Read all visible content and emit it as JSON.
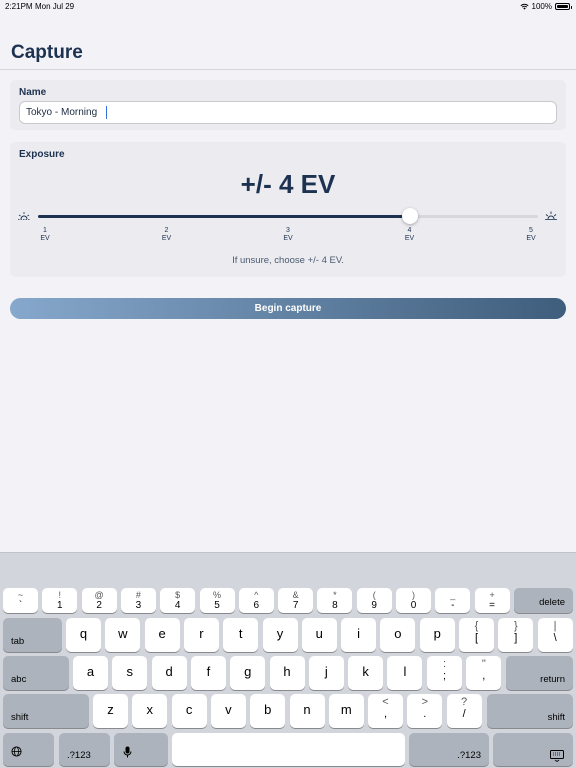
{
  "status": {
    "time": "2:21PM",
    "date": "Mon Jul 29",
    "battery": "100%"
  },
  "title": "Capture",
  "name_section": {
    "label": "Name",
    "value": "Tokyo - Morning"
  },
  "exposure": {
    "label": "Exposure",
    "value_text": "+/- 4 EV",
    "value": 4,
    "min": 1,
    "max": 5,
    "ticks": [
      {
        "num": "1",
        "unit": "EV"
      },
      {
        "num": "2",
        "unit": "EV"
      },
      {
        "num": "3",
        "unit": "EV"
      },
      {
        "num": "4",
        "unit": "EV"
      },
      {
        "num": "5",
        "unit": "EV"
      }
    ],
    "hint": "If unsure, choose +/- 4 EV."
  },
  "begin_button": "Begin capture",
  "keyboard": {
    "row1": [
      {
        "alt": "~",
        "main": "`"
      },
      {
        "alt": "!",
        "main": "1"
      },
      {
        "alt": "@",
        "main": "2"
      },
      {
        "alt": "#",
        "main": "3"
      },
      {
        "alt": "$",
        "main": "4"
      },
      {
        "alt": "%",
        "main": "5"
      },
      {
        "alt": "^",
        "main": "6"
      },
      {
        "alt": "&",
        "main": "7"
      },
      {
        "alt": "*",
        "main": "8"
      },
      {
        "alt": "(",
        "main": "9"
      },
      {
        "alt": ")",
        "main": "0"
      },
      {
        "alt": "_",
        "main": "-"
      },
      {
        "alt": "+",
        "main": "="
      }
    ],
    "delete": "delete",
    "tab": "tab",
    "row2": [
      "q",
      "w",
      "e",
      "r",
      "t",
      "y",
      "u",
      "i",
      "o",
      "p"
    ],
    "row2_punct": [
      {
        "alt": "{",
        "main": "["
      },
      {
        "alt": "}",
        "main": "]"
      },
      {
        "alt": "|",
        "main": "\\"
      }
    ],
    "abc": "abc",
    "row3": [
      "a",
      "s",
      "d",
      "f",
      "g",
      "h",
      "j",
      "k",
      "l"
    ],
    "row3_punct": [
      {
        "alt": ":",
        "main": ";"
      },
      {
        "alt": "\"",
        "main": ","
      }
    ],
    "return": "return",
    "shift": "shift",
    "row4": [
      "z",
      "x",
      "c",
      "v",
      "b",
      "n",
      "m"
    ],
    "row4_punct": [
      {
        "alt": "<",
        "main": ","
      },
      {
        "alt": ">",
        "main": "."
      },
      {
        "alt": "?",
        "main": "/"
      }
    ],
    "numbers": ".?123"
  }
}
